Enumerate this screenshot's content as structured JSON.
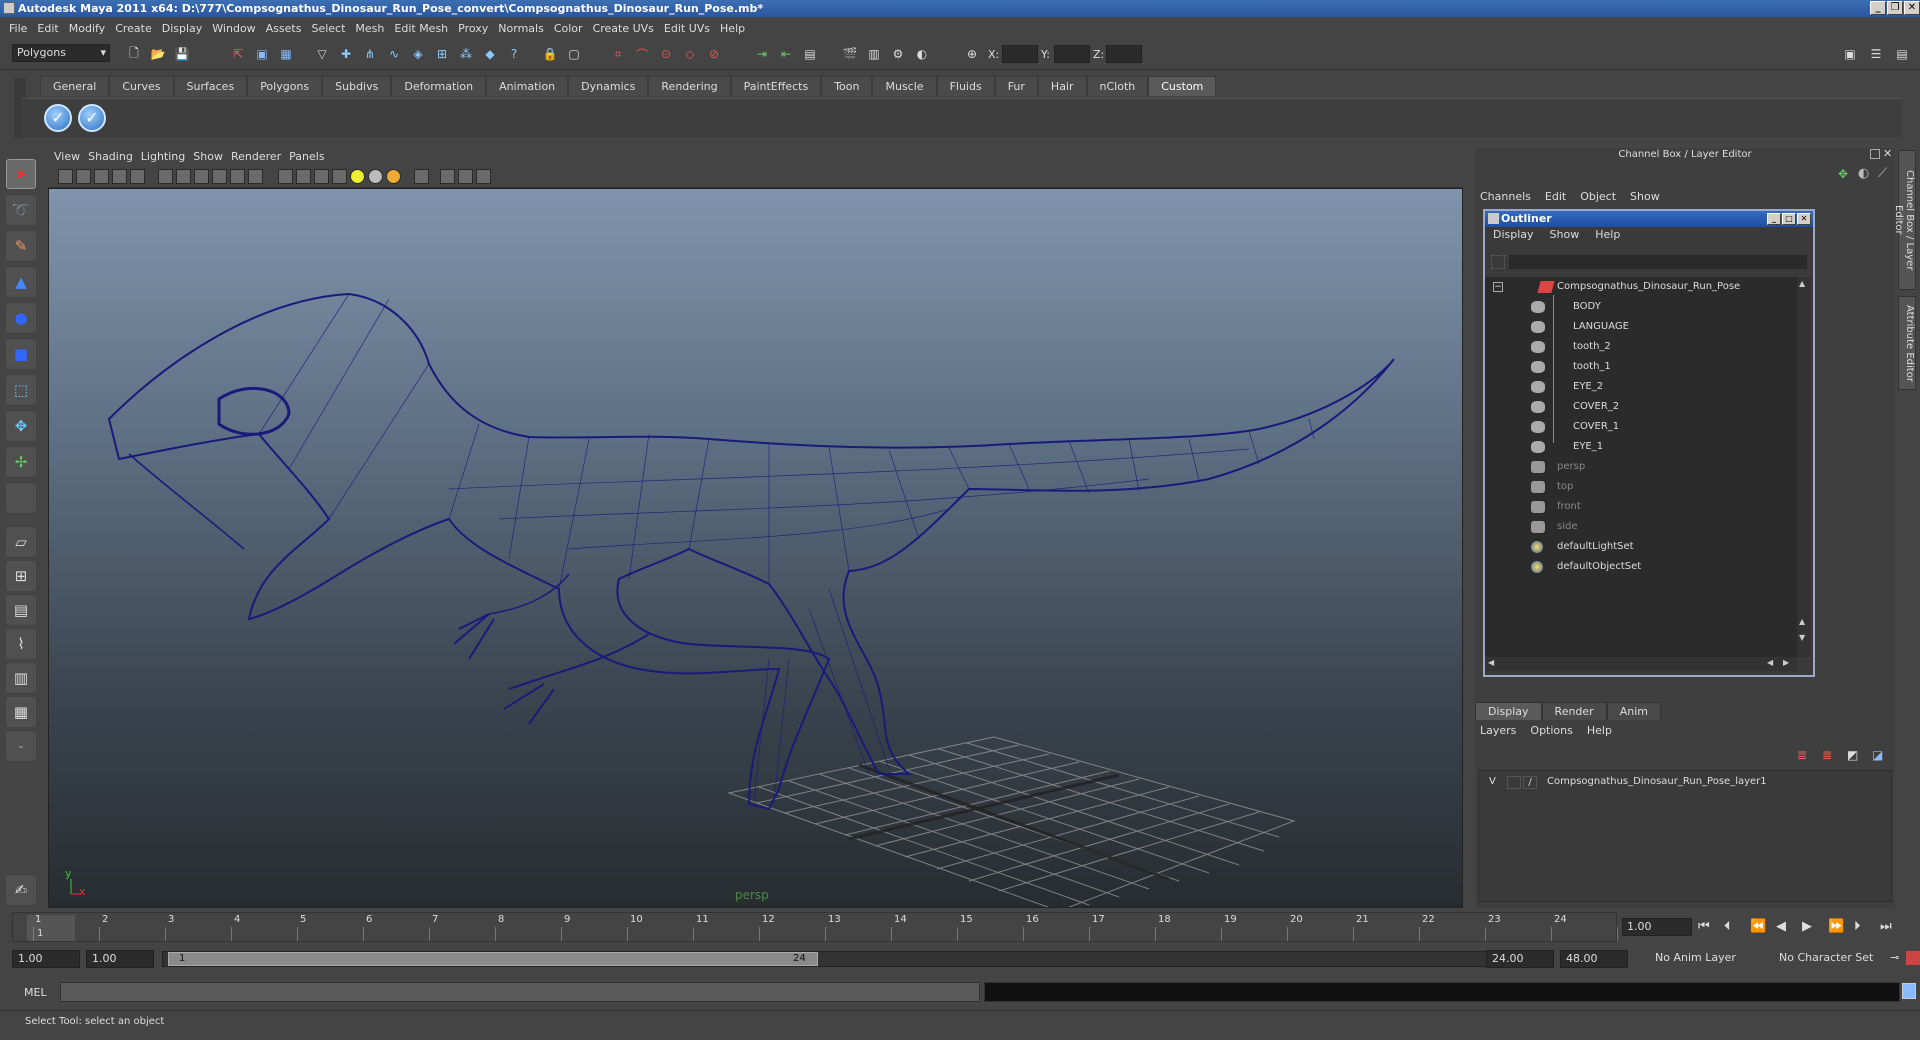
{
  "window": {
    "title": "Autodesk Maya 2011 x64: D:\\777\\Compsognathus_Dinosaur_Run_Pose_convert\\Compsognathus_Dinosaur_Run_Pose.mb*"
  },
  "menubar": [
    "File",
    "Edit",
    "Modify",
    "Create",
    "Display",
    "Window",
    "Assets",
    "Select",
    "Mesh",
    "Edit Mesh",
    "Proxy",
    "Normals",
    "Color",
    "Create UVs",
    "Edit UVs",
    "Help"
  ],
  "statusline": {
    "menuset": "Polygons",
    "x_label": "X:",
    "y_label": "Y:",
    "z_label": "Z:"
  },
  "shelf": {
    "tabs": [
      "General",
      "Curves",
      "Surfaces",
      "Polygons",
      "Subdivs",
      "Deformation",
      "Animation",
      "Dynamics",
      "Rendering",
      "PaintEffects",
      "Toon",
      "Muscle",
      "Fluids",
      "Fur",
      "Hair",
      "nCloth",
      "Custom"
    ],
    "active_tab": "Custom"
  },
  "viewport": {
    "menu": [
      "View",
      "Shading",
      "Lighting",
      "Show",
      "Renderer",
      "Panels"
    ],
    "camera_label": "persp",
    "mesh_color": "#1a1a7a",
    "axis_y": "y",
    "axis_x": "x"
  },
  "right_panel": {
    "header": "Channel Box / Layer Editor",
    "channel_menu": [
      "Channels",
      "Edit",
      "Object",
      "Show"
    ],
    "side_tabs": [
      "Channel Box / Layer Editor",
      "Attribute Editor"
    ]
  },
  "outliner": {
    "title": "Outliner",
    "menu": [
      "Display",
      "Show",
      "Help"
    ],
    "root": "Compsognathus_Dinosaur_Run_Pose",
    "children": [
      "BODY",
      "LANGUAGE",
      "tooth_2",
      "tooth_1",
      "EYE_2",
      "COVER_2",
      "COVER_1",
      "EYE_1"
    ],
    "cameras": [
      "persp",
      "top",
      "front",
      "side"
    ],
    "sets": [
      "defaultLightSet",
      "defaultObjectSet"
    ]
  },
  "layer_editor": {
    "tabs": [
      "Display",
      "Render",
      "Anim"
    ],
    "active_tab": "Display",
    "menu": [
      "Layers",
      "Options",
      "Help"
    ],
    "layers": [
      {
        "visible": "V",
        "name": "Compsognathus_Dinosaur_Run_Pose_layer1"
      }
    ]
  },
  "time_slider": {
    "ticks": [
      "1",
      "2",
      "3",
      "4",
      "5",
      "6",
      "7",
      "8",
      "9",
      "10",
      "11",
      "12",
      "13",
      "14",
      "15",
      "16",
      "17",
      "18",
      "19",
      "20",
      "21",
      "22",
      "23",
      "24"
    ],
    "current_frame_marker": "1",
    "current_time": "1.00"
  },
  "range_slider": {
    "start_time": "1.00",
    "playback_start": "1.00",
    "range_start_label": "1",
    "range_end_label": "24",
    "playback_end": "24.00",
    "end_time": "48.00",
    "anim_layer": "No Anim Layer",
    "character_set": "No Character Set"
  },
  "command_line": {
    "label": "MEL"
  },
  "help_line": {
    "text": "Select Tool: select an object"
  }
}
